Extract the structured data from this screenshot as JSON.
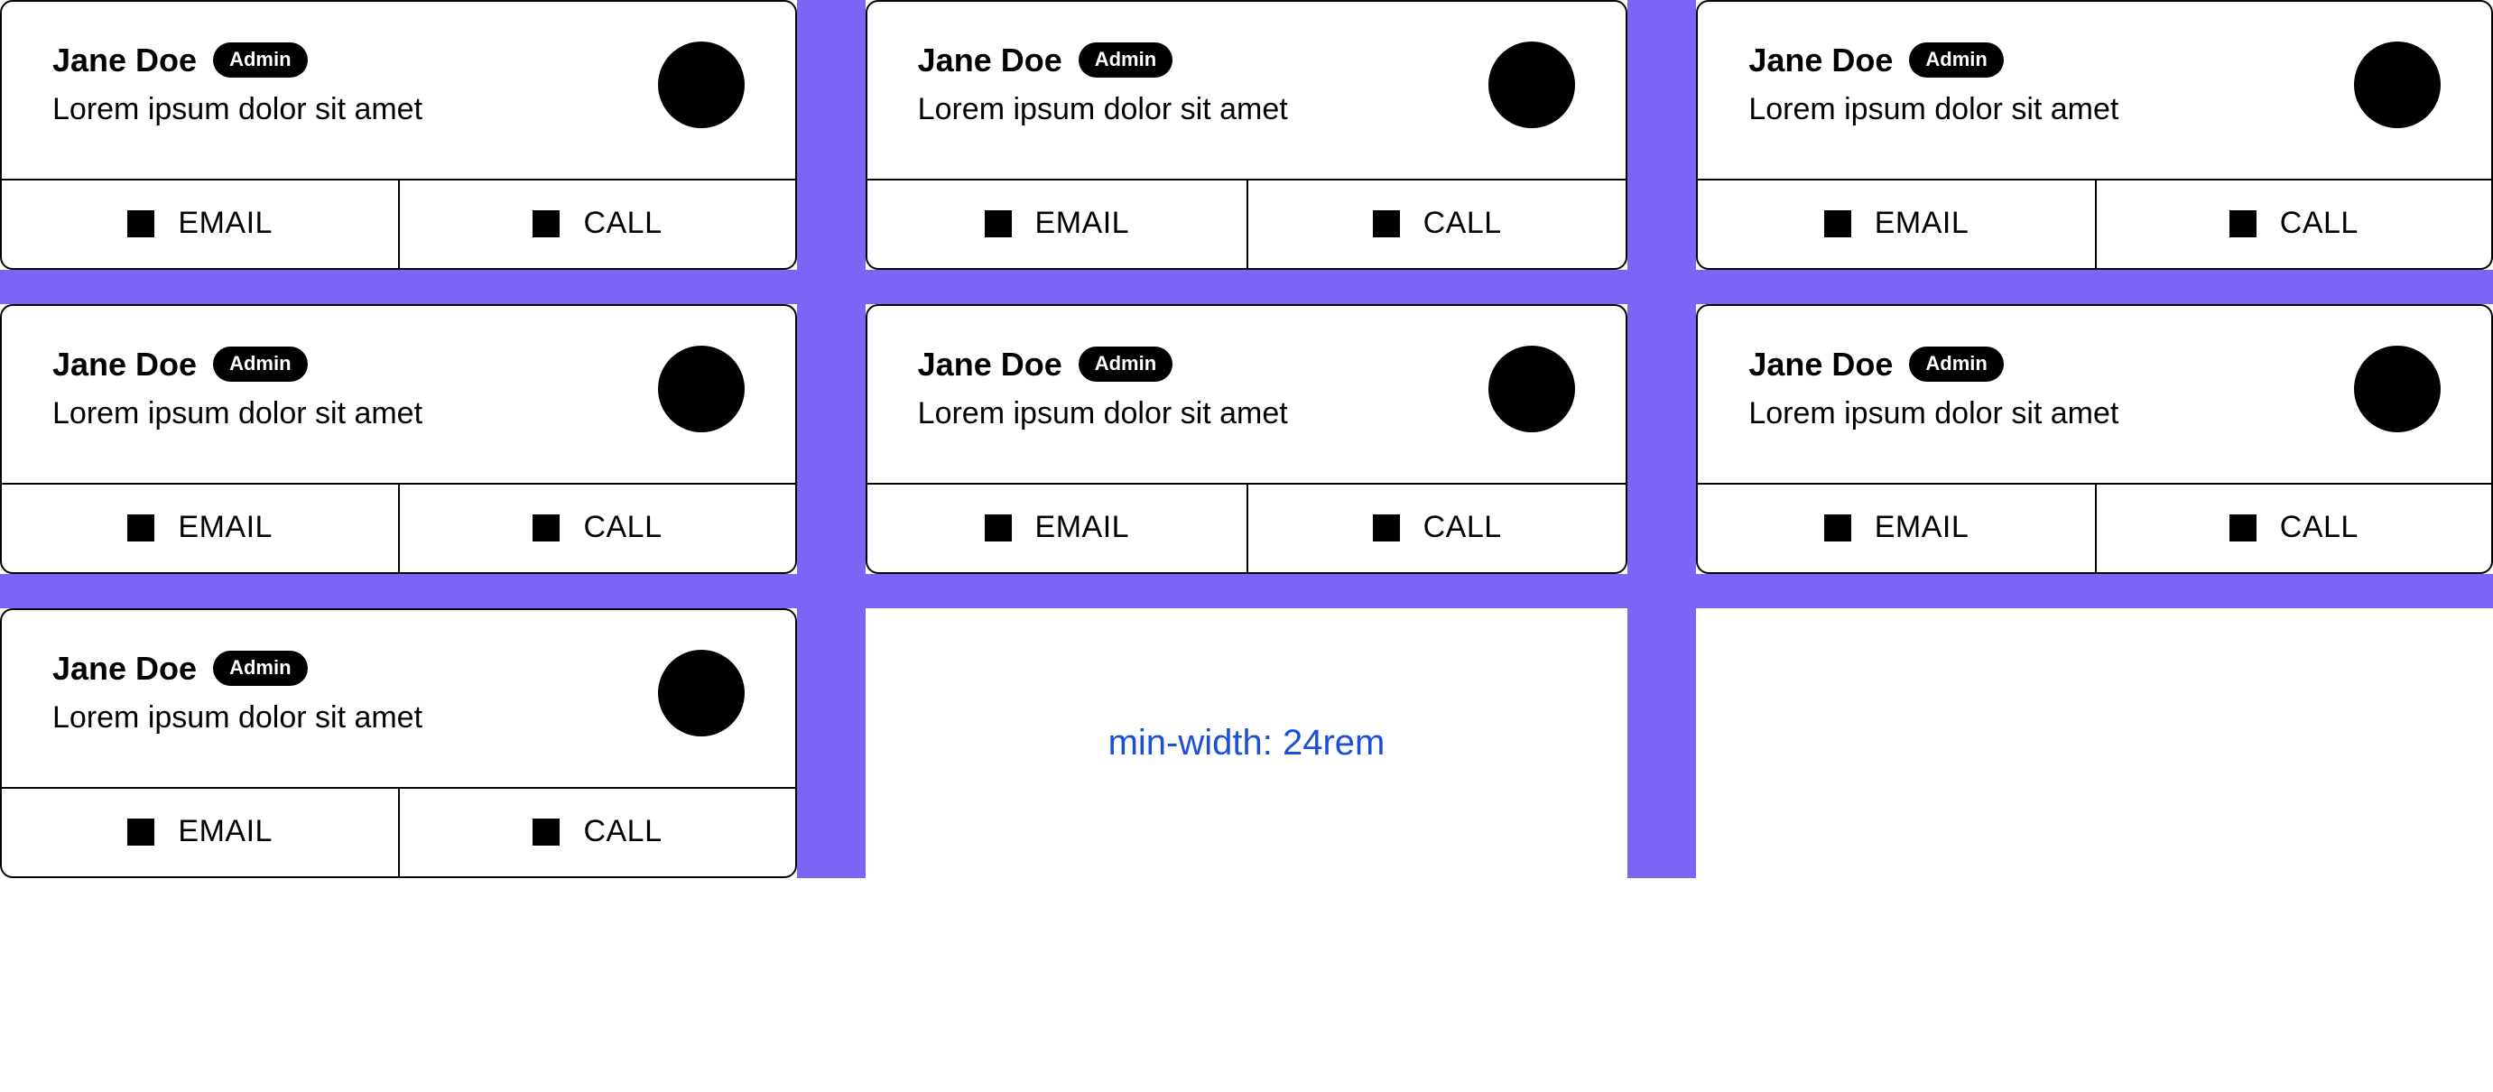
{
  "card": {
    "name": "Jane Doe",
    "badge": "Admin",
    "description": "Lorem ipsum dolor sit amet",
    "email_label": "EMAIL",
    "call_label": "CALL"
  },
  "annotation": "min-width: 24rem",
  "colors": {
    "accent": "#7c64f5",
    "link": "#1a4fd6"
  }
}
